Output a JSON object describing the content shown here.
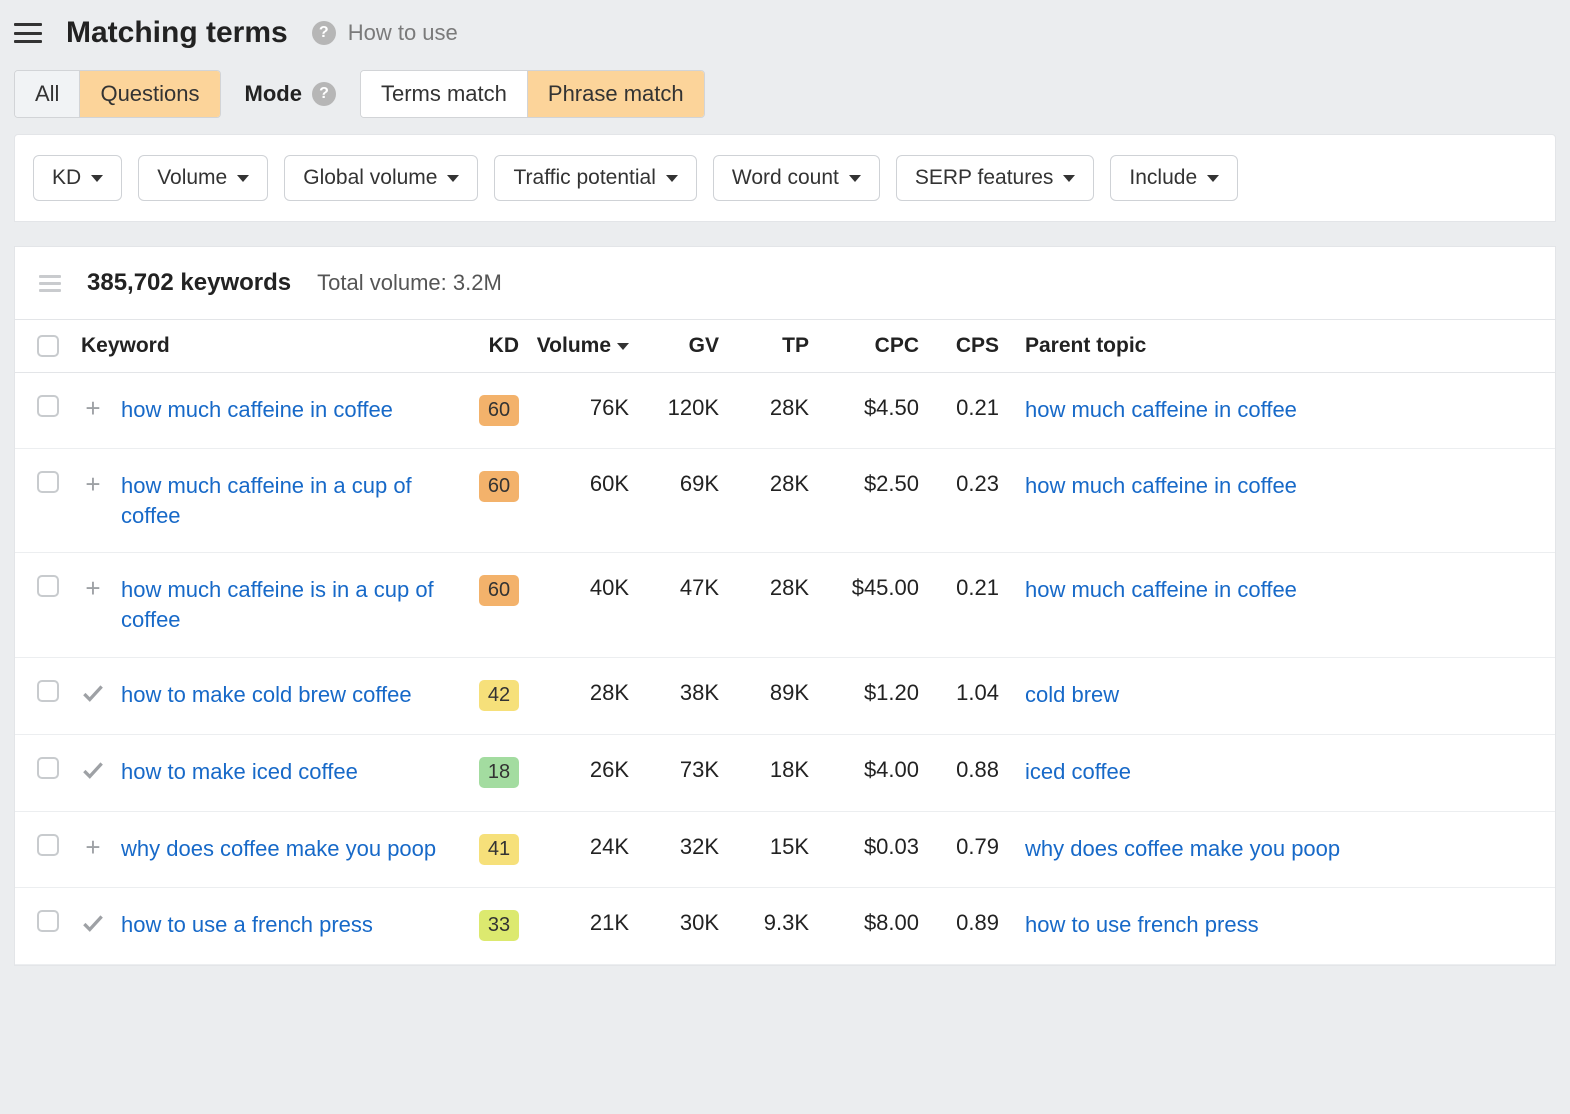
{
  "header": {
    "title": "Matching terms",
    "how_to_use": "How to use"
  },
  "type_tabs": {
    "all": "All",
    "questions": "Questions"
  },
  "mode": {
    "label": "Mode",
    "terms": "Terms match",
    "phrase": "Phrase match"
  },
  "filters": {
    "kd": "KD",
    "volume": "Volume",
    "global_volume": "Global volume",
    "traffic_potential": "Traffic potential",
    "word_count": "Word count",
    "serp_features": "SERP features",
    "include": "Include"
  },
  "summary": {
    "keyword_count": "385,702 keywords",
    "total_volume": "Total volume: 3.2M"
  },
  "columns": {
    "keyword": "Keyword",
    "kd": "KD",
    "volume": "Volume",
    "gv": "GV",
    "tp": "TP",
    "cpc": "CPC",
    "cps": "CPS",
    "parent": "Parent topic"
  },
  "kd_colors": {
    "orange": "#f3b26b",
    "yellow": "#f6e07a",
    "lime": "#dce96f",
    "green": "#a3dca0"
  },
  "rows": [
    {
      "icon": "plus",
      "keyword": "how much caffeine in coffee",
      "kd": 60,
      "kd_color": "orange",
      "volume": "76K",
      "gv": "120K",
      "tp": "28K",
      "cpc": "$4.50",
      "cps": "0.21",
      "parent": "how much caffeine in coffee"
    },
    {
      "icon": "plus",
      "keyword": "how much caffeine in a cup of coffee",
      "kd": 60,
      "kd_color": "orange",
      "volume": "60K",
      "gv": "69K",
      "tp": "28K",
      "cpc": "$2.50",
      "cps": "0.23",
      "parent": "how much caffeine in coffee"
    },
    {
      "icon": "plus",
      "keyword": "how much caffeine is in a cup of coffee",
      "kd": 60,
      "kd_color": "orange",
      "volume": "40K",
      "gv": "47K",
      "tp": "28K",
      "cpc": "$45.00",
      "cps": "0.21",
      "parent": "how much caffeine in coffee"
    },
    {
      "icon": "check",
      "keyword": "how to make cold brew coffee",
      "kd": 42,
      "kd_color": "yellow",
      "volume": "28K",
      "gv": "38K",
      "tp": "89K",
      "cpc": "$1.20",
      "cps": "1.04",
      "parent": "cold brew"
    },
    {
      "icon": "check",
      "keyword": "how to make iced coffee",
      "kd": 18,
      "kd_color": "green",
      "volume": "26K",
      "gv": "73K",
      "tp": "18K",
      "cpc": "$4.00",
      "cps": "0.88",
      "parent": "iced coffee"
    },
    {
      "icon": "plus",
      "keyword": "why does coffee make you poop",
      "kd": 41,
      "kd_color": "yellow",
      "volume": "24K",
      "gv": "32K",
      "tp": "15K",
      "cpc": "$0.03",
      "cps": "0.79",
      "parent": "why does coffee make you poop"
    },
    {
      "icon": "check",
      "keyword": "how to use a french press",
      "kd": 33,
      "kd_color": "lime",
      "volume": "21K",
      "gv": "30K",
      "tp": "9.3K",
      "cpc": "$8.00",
      "cps": "0.89",
      "parent": "how to use french press"
    }
  ]
}
